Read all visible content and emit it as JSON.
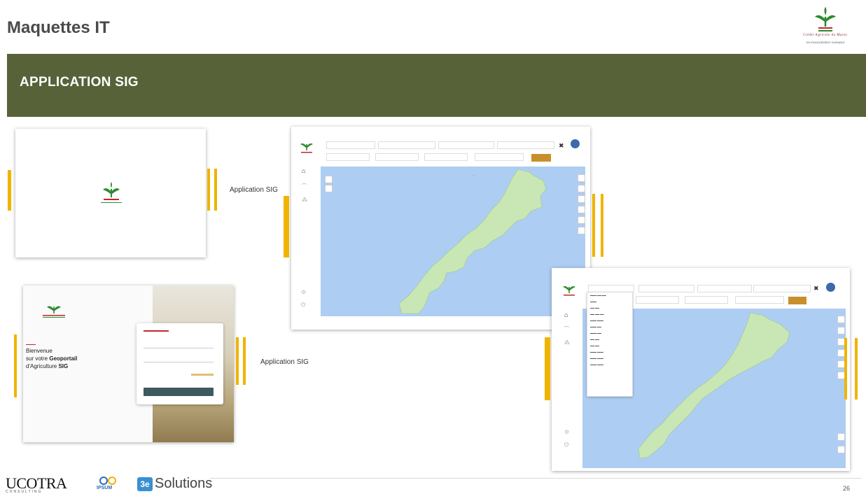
{
  "header": {
    "title": "Maquettes IT",
    "brand_logo_text": "Crédit Agricole du Maroc",
    "brand_tagline": "UN ENGAGEMENT DURABLE"
  },
  "banner": {
    "title": "APPLICATION SIG"
  },
  "captions": {
    "caption_1": "Application SIG",
    "caption_2": "Application SIG"
  },
  "login_mockup": {
    "welcome_line_1": "Bienvenue",
    "welcome_line_2": "sur votre",
    "welcome_bold": "Geoportail",
    "welcome_line_3": "d'Agriculture",
    "welcome_bold_2": "SIG"
  },
  "map_icons": [
    "home-icon",
    "chart-icon",
    "network-icon",
    "settings-icon",
    "power-icon",
    "zoom-in-icon",
    "zoom-out-icon",
    "filter-icon",
    "layers-icon",
    "pencil-icon"
  ],
  "colors": {
    "banner": "#576238",
    "accent_yellow": "#f0b400",
    "sea": "#aecdf3",
    "land": "#c9e6b5",
    "validate_button": "#c8902c",
    "login_button": "#3f5a5e"
  },
  "footer": {
    "brand_1": "UCOTRA",
    "brand_1_sub": "CONSULTING",
    "brand_2": "IPSUM",
    "brand_3_prefix": "3e",
    "brand_3": "Solutions",
    "page_number": "26"
  }
}
